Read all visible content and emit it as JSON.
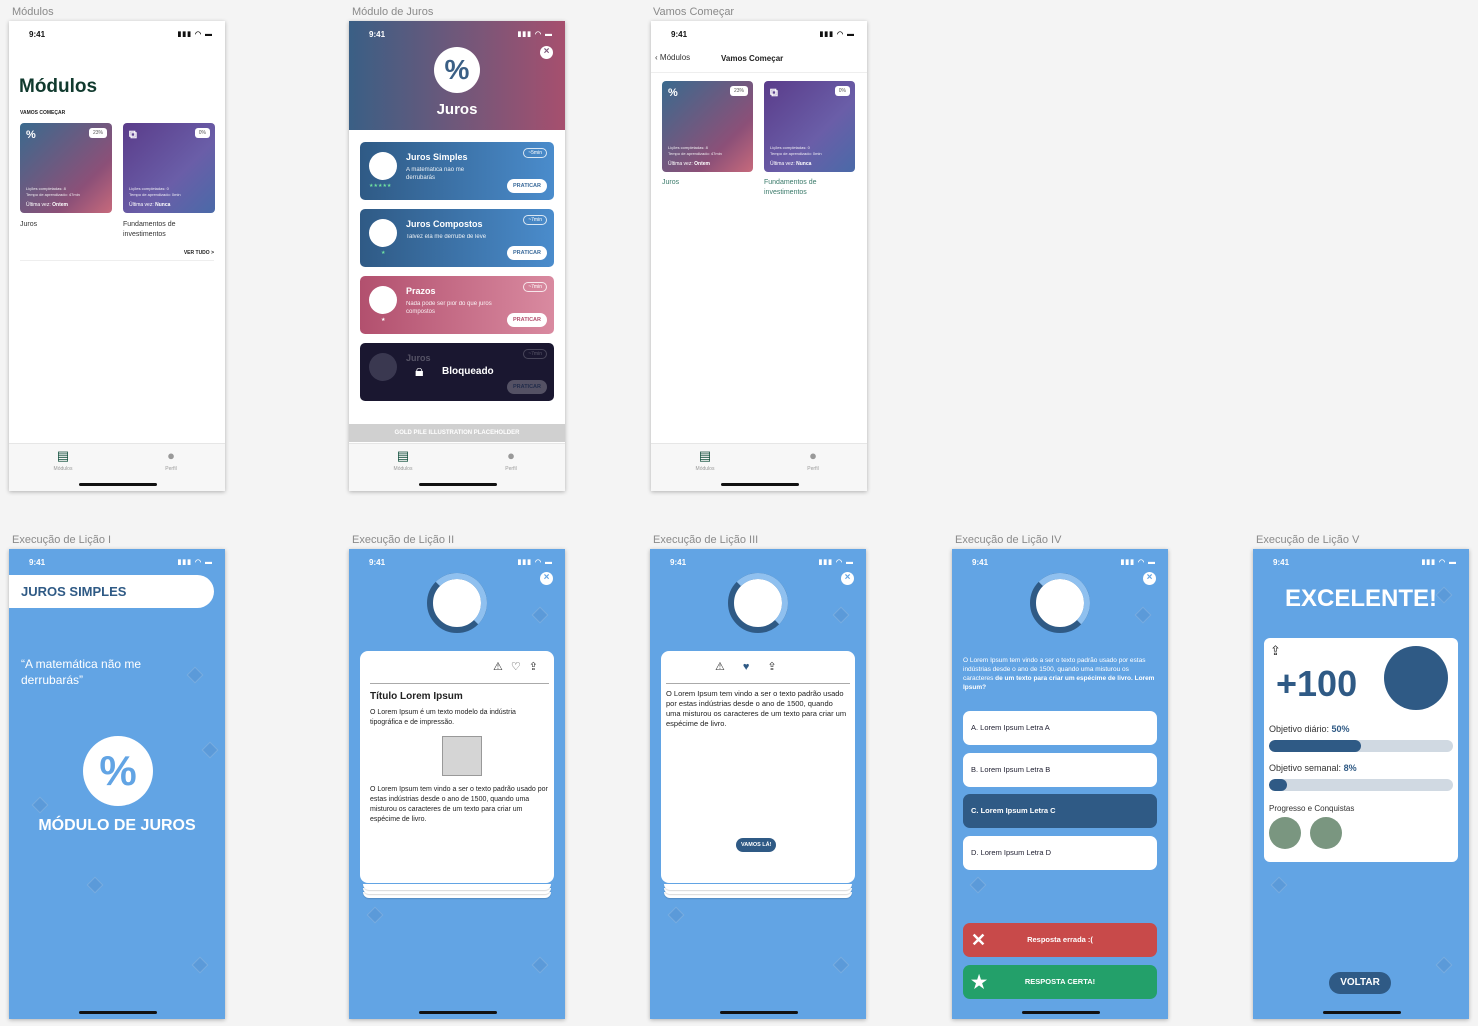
{
  "frames": {
    "modulos": "Módulos",
    "modulo_juros": "Módulo de Juros",
    "vamos": "Vamos Começar",
    "exec1": "Execução de Lição I",
    "exec2": "Execução de Lição II",
    "exec3": "Execução de Lição III",
    "exec4": "Execução de Lição IV",
    "exec5": "Execução de Lição V"
  },
  "status_time": "9:41",
  "tabbar": {
    "modulos": "Módulos",
    "perfil": "Perfil"
  },
  "modules_screen": {
    "title": "Módulos",
    "section": "VAMOS COMEÇAR",
    "see_all": "VER TUDO >",
    "cards": [
      {
        "name": "Juros",
        "percent": "23%",
        "lessons": "Lições completadas: 8",
        "time": "Tempo de aprendizado: 47min",
        "last_label": "Última vez:",
        "last_value": "Ontem"
      },
      {
        "name": "Fundamentos de investimentos",
        "percent": "0%",
        "lessons": "Lições completadas: 0",
        "time": "Tempo de aprendizado: 0min",
        "last_label": "Última vez:",
        "last_value": "Nunca"
      }
    ]
  },
  "juros_screen": {
    "title": "Juros",
    "lessons": [
      {
        "title": "Juros Simples",
        "desc": "A matemática não me derrubarás",
        "time": "~5min",
        "stars": "★★★★★",
        "cta": "PRATICAR"
      },
      {
        "title": "Juros Compostos",
        "desc": "Talvez ela me derrube de leve",
        "time": "~7min",
        "stars": "★",
        "cta": "PRATICAR"
      },
      {
        "title": "Prazos",
        "desc": "Nada pode ser pior do que juros compostos",
        "time": "~7min",
        "stars": "★",
        "cta": "PRATICAR"
      },
      {
        "title": "Juros",
        "desc": "",
        "time": "~7min",
        "stars": "",
        "cta": "PRATICAR",
        "locked": "Bloqueado"
      }
    ],
    "placeholder": "GOLD PILE ILLUSTRATION PLACEHOLDER"
  },
  "vamos_screen": {
    "back": "Módulos",
    "title": "Vamos Começar"
  },
  "exec1": {
    "pill": "JUROS SIMPLES",
    "quote": "“A matemática não me derrubarás”",
    "module": "MÓDULO DE JUROS"
  },
  "exec2": {
    "card_title": "Título Lorem Ipsum",
    "p1": "O Lorem Ipsum é um texto modelo da indústria tipográfica e de impressão.",
    "p2": "O Lorem Ipsum tem vindo a ser o texto padrão usado por estas indústrias desde o ano de 1500, quando uma misturou os caracteres de um texto para criar um espécime de livro."
  },
  "exec3": {
    "p1": "O Lorem Ipsum tem vindo a ser o texto padrão usado por estas indústrias desde o ano de 1500, quando uma misturou os caracteres de um texto para criar um espécime de livro.",
    "cta": "VAMOS LÁ!"
  },
  "exec4": {
    "question_a": "O Lorem Ipsum tem vindo a ser o texto padrão usado por estas indústrias desde o ano de 1500, quando uma misturou os caracteres ",
    "question_b": "de um texto para criar um espécime de livro. Lorem Ipsum?",
    "options": [
      "A. Lorem Ipsum Letra A",
      "B. Lorem Ipsum Letra B",
      "C. Lorem Ipsum Letra C",
      "D. Lorem Ipsum Letra D"
    ],
    "wrong": "Resposta errada :(",
    "right": "RESPOSTA CERTA!"
  },
  "exec5": {
    "headline": "EXCELENTE!",
    "points": "+100",
    "daily_label": "Objetivo diário:",
    "daily_value": "50%",
    "daily_progress": 0.5,
    "weekly_label": "Objetivo semanal:",
    "weekly_value": "8%",
    "weekly_progress": 0.08,
    "achievements": "Progresso e Conquistas",
    "cta": "VOLTAR"
  },
  "colors": {
    "blue": "#62a4e4",
    "navy": "#2f5a85",
    "wrong": "#c84a4a",
    "right": "#23a06a",
    "dark": "#1a1730"
  }
}
